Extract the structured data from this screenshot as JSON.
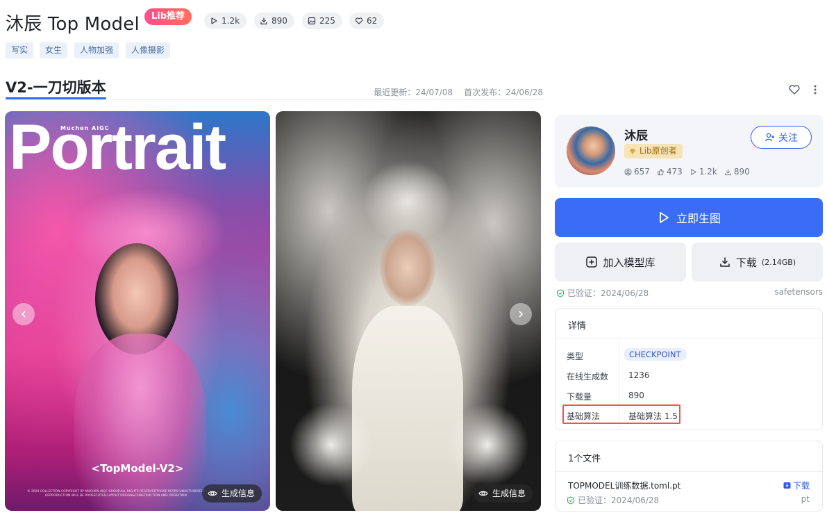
{
  "header": {
    "title": "沐辰 Top Model",
    "badge": "Lib推荐",
    "stats": {
      "runs": "1.2k",
      "downloads": "890",
      "images": "225",
      "likes": "62"
    },
    "tags": [
      "写实",
      "女生",
      "人物加强",
      "人像摄影"
    ]
  },
  "version": {
    "name": "V2-一刀切版本",
    "updated": "最近更新：24/07/08",
    "published": "首次发布：24/06/28"
  },
  "gallery": {
    "card1": {
      "headline": "Portrait",
      "brand": "Muchen AIGC",
      "caption": "<TopModel-V2>",
      "fine_print": "© 2024 COLLECTION.COPYRIGHT BY MUCHEN AIGC GROUP.ALL RIGHTS RESERVEDTHOSE RESPO UNAUTHORIZED REPRODUCTION WILL BE PROSECUTED.LAYOUT DESIGN&CONSTRUCTION AND OPERATION",
      "gen_info": "生成信息"
    },
    "card2": {
      "gen_info": "生成信息"
    }
  },
  "author": {
    "name": "沐辰",
    "badge": "Lib原创者",
    "follow": "关注",
    "stats": {
      "followers": "657",
      "likes": "473",
      "runs": "1.2k",
      "downloads": "890"
    }
  },
  "actions": {
    "generate": "立即生图",
    "add_library": "加入模型库",
    "download": "下载",
    "download_size": "(2.14GB)"
  },
  "verification": {
    "status": "已验证：2024/06/28",
    "format": "safetensors"
  },
  "details": {
    "title": "详情",
    "rows": [
      {
        "label": "类型",
        "value": "CHECKPOINT"
      },
      {
        "label": "在线生成数",
        "value": "1236"
      },
      {
        "label": "下载量",
        "value": "890"
      },
      {
        "label": "基础算法",
        "value": "基础算法 1.5"
      }
    ]
  },
  "files": {
    "title": "1个文件",
    "name": "TOPMODEL训练数据.toml.pt",
    "download": "下载",
    "verified": "已验证：2024/06/28",
    "ext": "pt"
  },
  "colors": {
    "accent": "#3b6cf6",
    "badge_gradient_start": "#ff4f8b",
    "badge_gradient_end": "#ff6f5a",
    "highlight_border": "#e8574c",
    "verified_green": "#2fb36b"
  }
}
